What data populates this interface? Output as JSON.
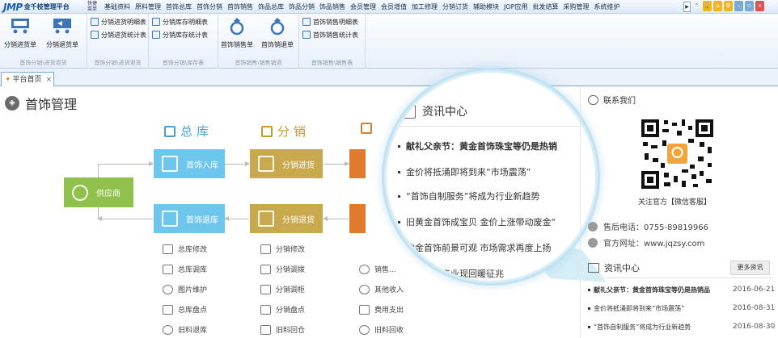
{
  "app": {
    "logo_mark": "JMP",
    "logo_name": "金千枝管理平台",
    "quick_menu": [
      "快捷",
      "菜单"
    ]
  },
  "menu": [
    "基础资料",
    "原料管理",
    "首饰总库",
    "首饰分销",
    "首饰销售",
    "饰品总库",
    "饰品分销",
    "饰品销售",
    "会员管理",
    "会员增值",
    "加工修理",
    "分销订货",
    "辅助模块",
    "JOP应用",
    "批发结算",
    "采购管理",
    "系统维护"
  ],
  "ribbon": {
    "groups": [
      {
        "label": "首饰分销\\进货退货",
        "big": [
          "分销进货单",
          "分销退货单"
        ]
      },
      {
        "label": "首饰分销\\进货退货",
        "small": [
          "分销进货明细表",
          "分销进货统计表"
        ]
      },
      {
        "label": "首饰分销\\库存表",
        "small": [
          "分销库存明细表",
          "分销库存统计表"
        ]
      },
      {
        "label": "首饰销售\\销售销退",
        "big": [
          "首饰销售单",
          "首饰销退单"
        ]
      },
      {
        "label": "首饰销售\\销售表",
        "small": [
          "首饰销售明细表",
          "首饰销售统计表"
        ]
      }
    ]
  },
  "tabs": [
    {
      "label": "平台首页",
      "close": "×"
    }
  ],
  "page": {
    "title": "首饰管理"
  },
  "sections": {
    "warehouse": "总库",
    "distribution": "分销"
  },
  "flow": {
    "supplier": "供应商",
    "warehouse_in": "首饰入库",
    "warehouse_return": "首饰退库",
    "dist_in": "分销进货",
    "dist_return": "分销退货"
  },
  "ops": {
    "warehouse": [
      "总库修改",
      "总库调库",
      "图片维护",
      "总库盘点",
      "旧料退库"
    ],
    "distribution": [
      "分销修改",
      "分销调拨",
      "分销调柜",
      "分销盘点",
      "旧料回仓"
    ],
    "sales": [
      "销售...",
      "其他收入",
      "费用支出",
      "旧料回收"
    ]
  },
  "magnifier": {
    "title": "资讯中心",
    "items": [
      {
        "text": "献礼父亲节：黄金首饰珠宝等仍是热销",
        "bold": true
      },
      {
        "text": "金价将抵涌即将到来“市场震荡”",
        "bold": false
      },
      {
        "text": "“首饰自制服务”将成为行业新趋势",
        "bold": false
      },
      {
        "text": "旧黄金首饰成宝贝 金价上涨带动废金“",
        "bold": false
      },
      {
        "text": "铂金首饰前景可观 市场需求再度上扬",
        "bold": false
      },
      {
        "text": "广东珠宝产业现回暖征兆",
        "bold": false
      }
    ]
  },
  "contact": {
    "title": "联系我们",
    "qr_caption": "关注官方【微信客服】",
    "phone": "售后电话：0755-89819966",
    "website": "官方网址：www.jqzsy.com"
  },
  "news": {
    "title": "资讯中心",
    "more": "更多资讯",
    "items": [
      {
        "text": "献礼父亲节：黄金首饰珠宝等仍是热销品",
        "date": "2016-06-21",
        "bold": true
      },
      {
        "text": "金价将抵涌即将到来“市场震荡”",
        "date": "2016-08-31",
        "bold": false
      },
      {
        "text": "“首饰自制服务”将成为行业新趋势",
        "date": "2016-08-30",
        "bold": false
      }
    ]
  },
  "colors": {
    "supplier": "#8fc14c",
    "warehouse": "#6ec6ec",
    "distribution": "#c9a94d",
    "sales": "#e07a2c",
    "accent": "#1a5fb4"
  }
}
